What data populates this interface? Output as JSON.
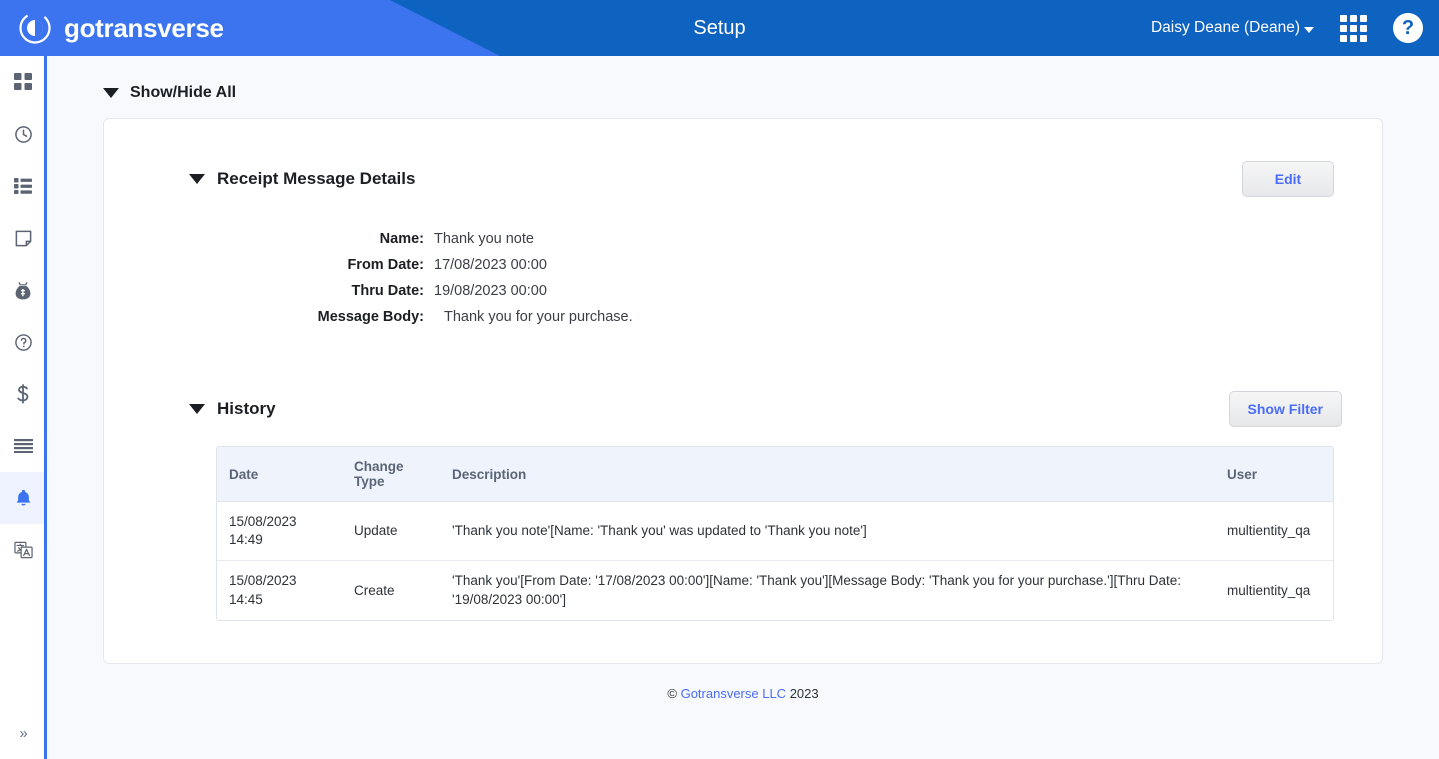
{
  "header": {
    "brand": "gotransverse",
    "title": "Setup",
    "user": "Daisy Deane (Deane)",
    "grid_icon": "apps-grid-icon",
    "help_icon": "?",
    "color_left": "#3b74ee",
    "color_right": "#0f63c0"
  },
  "sidebar": {
    "items": [
      {
        "icon": "dashboard-grid-icon",
        "active": false
      },
      {
        "icon": "clock-icon",
        "active": false
      },
      {
        "icon": "list-icon",
        "active": false
      },
      {
        "icon": "document-icon",
        "active": false
      },
      {
        "icon": "money-bag-icon",
        "active": false
      },
      {
        "icon": "question-circle-icon",
        "active": false
      },
      {
        "icon": "dollar-sign-icon",
        "active": false
      },
      {
        "icon": "menu-lines-icon",
        "active": false
      },
      {
        "icon": "bell-icon",
        "active": true
      },
      {
        "icon": "translate-icon",
        "active": false
      }
    ],
    "expand_label": "»"
  },
  "main": {
    "show_hide_all": "Show/Hide All",
    "details": {
      "title": "Receipt Message Details",
      "edit_label": "Edit",
      "fields": [
        {
          "label": "Name:",
          "value": "Thank you note",
          "indented": false
        },
        {
          "label": "From Date:",
          "value": "17/08/2023 00:00",
          "indented": false
        },
        {
          "label": "Thru Date:",
          "value": "19/08/2023 00:00",
          "indented": false
        },
        {
          "label": "Message Body:",
          "value": "Thank you for your purchase.",
          "indented": true
        }
      ]
    },
    "history": {
      "title": "History",
      "show_filter_label": "Show Filter",
      "columns": [
        "Date",
        "Change Type",
        "Description",
        "User"
      ],
      "rows": [
        {
          "date": "15/08/2023\n14:49",
          "change_type": "Update",
          "description": "'Thank you note'[Name: 'Thank you' was updated to 'Thank you note']",
          "user": "multientity_qa"
        },
        {
          "date": "15/08/2023\n14:45",
          "change_type": "Create",
          "description": "'Thank you'[From Date: '17/08/2023 00:00'][Name: 'Thank you'][Message Body: 'Thank you for your purchase.'][Thru Date: '19/08/2023 00:00']",
          "user": "multientity_qa"
        }
      ]
    }
  },
  "footer": {
    "copyright_symbol": "©",
    "company": "Gotransverse LLC",
    "year": "2023"
  }
}
